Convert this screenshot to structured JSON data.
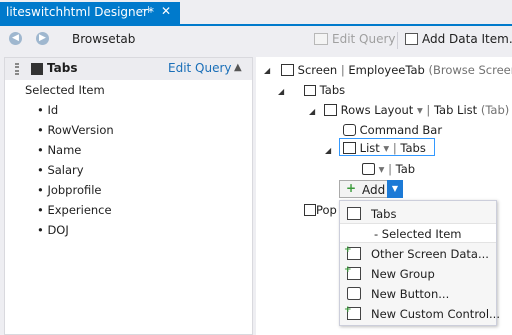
{
  "tab": {
    "title": "liteswitchhtml Designer*",
    "pin": "⊣",
    "close": "✕"
  },
  "toolbar": {
    "back": "◀",
    "forward": "▶",
    "title": "Browsetab",
    "edit_query": "Edit Query",
    "add_data_item": "Add Data Item..."
  },
  "left_panel": {
    "title": "Tabs",
    "edit_query": "Edit Query",
    "collapse": "▲",
    "selected_item": "Selected Item",
    "fields": [
      "Id",
      "RowVersion",
      "Name",
      "Salary",
      "Jobprofile",
      "Experience",
      "DOJ"
    ]
  },
  "tree": {
    "screen": {
      "label": "Screen",
      "name": "EmployeeTab",
      "type": "(Browse Screen)"
    },
    "tabs": "Tabs",
    "rows_layout": {
      "label": "Rows Layout",
      "name": "Tab List",
      "type": "(Tab)"
    },
    "command_bar": "Command Bar",
    "list": {
      "label": "List",
      "name": "Tabs"
    },
    "tab_child": "Tab",
    "add": "Add",
    "popups_partial": "Pop"
  },
  "add_menu": {
    "items": [
      {
        "label": "Tabs",
        "icon": "list-icon"
      },
      {
        "label": "- Selected Item",
        "icon": ""
      },
      {
        "label": "Other Screen Data...",
        "icon": "data-item-icon"
      },
      {
        "label": "New Group",
        "icon": "group-icon"
      },
      {
        "label": "New Button...",
        "icon": "button-icon"
      },
      {
        "label": "New Custom Control...",
        "icon": "custom-control-icon"
      }
    ]
  },
  "colors": {
    "accent": "#007acc",
    "link": "#1a6fb8",
    "dropdown": "#1c7ad6"
  }
}
